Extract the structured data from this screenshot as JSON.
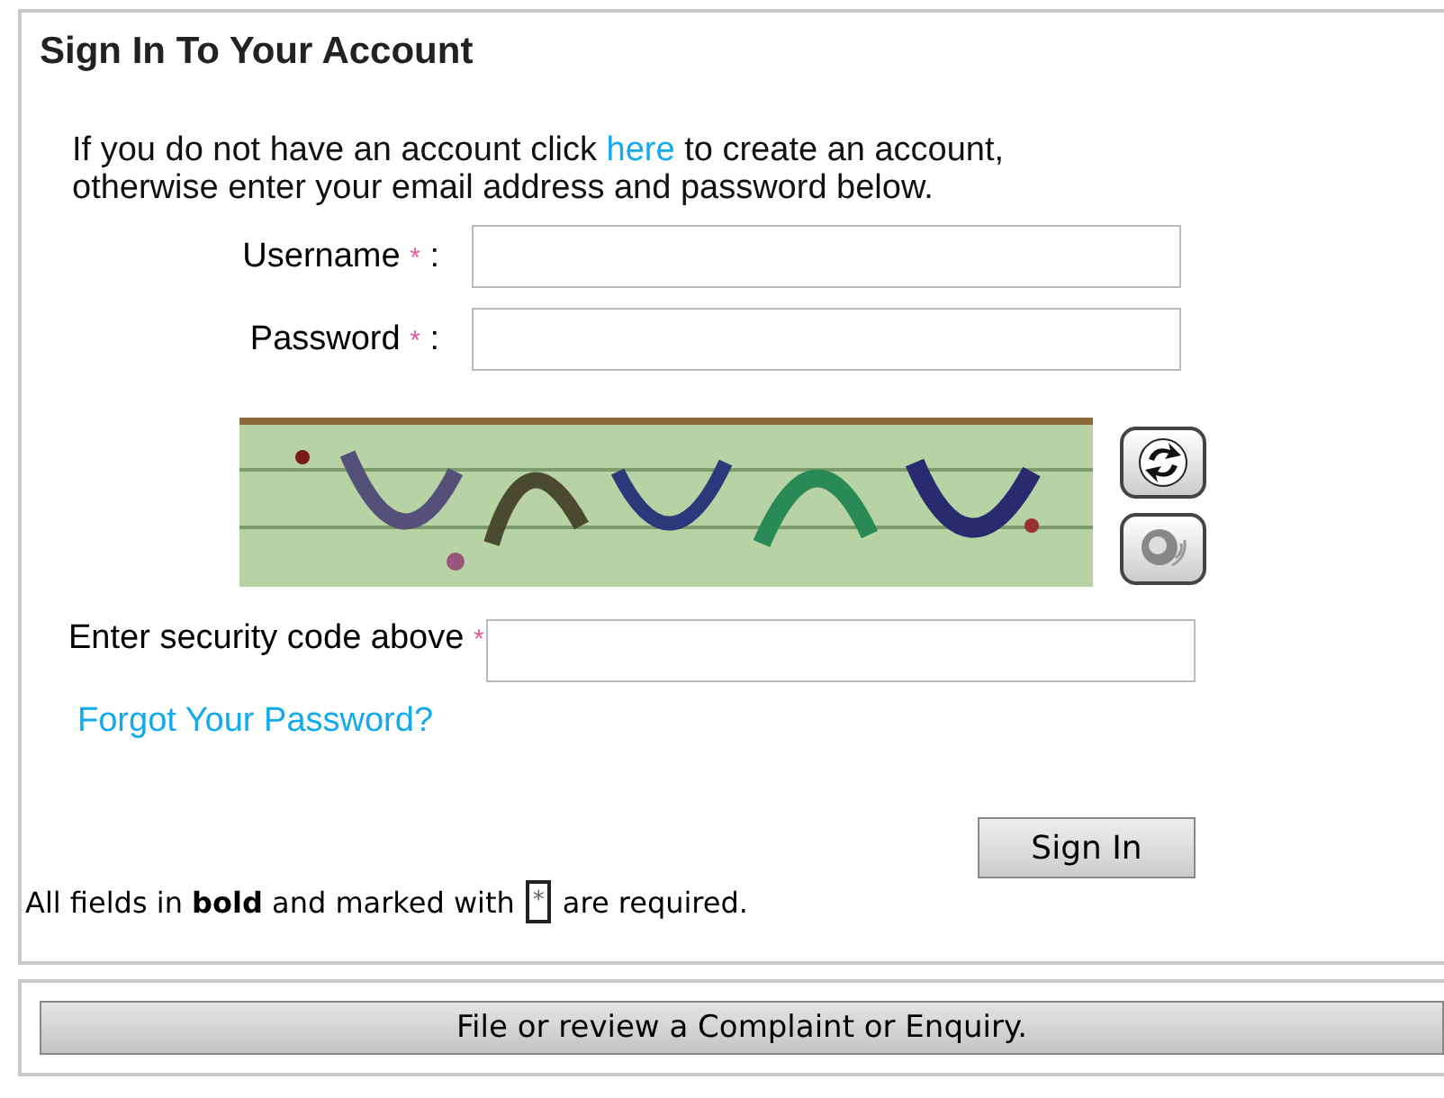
{
  "title": "Sign In To Your Account",
  "intro": "If you do not have an account click ",
  "intro_link": "here",
  "intro_rest": " to create an account, otherwise enter your email address and password below.",
  "fields": [
    {
      "label": "Username",
      "required_mark": "*",
      "separator": ":"
    },
    {
      "label": "Password",
      "required_mark": "*",
      "separator": ":"
    }
  ],
  "security": {
    "label": "Enter security code above",
    "required_mark": "*"
  },
  "forgot_link": "Forgot Your Password?",
  "submit": "Sign In",
  "note": {
    "before": "All fields in **bold** and marked with",
    "marker": "*",
    "after": "are required."
  },
  "complaint_button": "File or review a Complaint or Enquiry."
}
